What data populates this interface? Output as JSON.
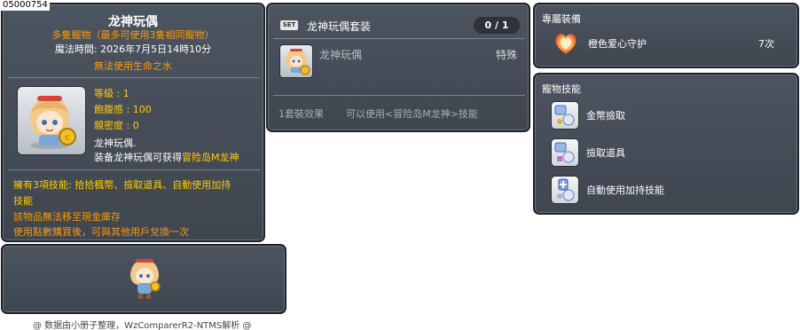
{
  "id_tag": "05000754",
  "item": {
    "title": "龙神玩偶",
    "subtitle": "多隻寵物（最多可使用3隻相同寵物）",
    "magic_time": "魔法時間:  2026年7月5日14時10分",
    "no_life_water": "無法使用生命之水",
    "stats": {
      "level": "等級 : 1",
      "fullness": "飽腹感 : 100",
      "closeness": "親密度 : 0"
    },
    "desc_line1": "龙神玩偶.",
    "desc_line2_prefix": "装备龙神玩偶可获得",
    "desc_line2_highlight": "冒险岛M龙神",
    "skills_line1": "擁有3項技能: 拾拾楓幣、撿取道具、自動使用加持",
    "skills_line2": "技能",
    "note1": "該物品無法移至現金庫存",
    "note2": "使用點數購買後，可與其他用戶兌換一次"
  },
  "footer": "@ 数据由小册子整理，WzComparerR2-NTMS解析 @",
  "set": {
    "badge": "SET",
    "title": "龙神玩偶套装",
    "count": "0 / 1",
    "item_name": "龙神玩偶",
    "item_tag": "特殊",
    "effect_label": "1套裝效果",
    "effect_desc": "可以使用<冒险岛M龙神>技能"
  },
  "exclusive": {
    "header": "專屬裝備",
    "name": "橙色爱心守护",
    "days": "7次"
  },
  "pet_skills": {
    "header": "寵物技能",
    "items": [
      {
        "label": "金幣撿取"
      },
      {
        "label": "撿取道具"
      },
      {
        "label": "自動使用加持技能"
      }
    ]
  }
}
